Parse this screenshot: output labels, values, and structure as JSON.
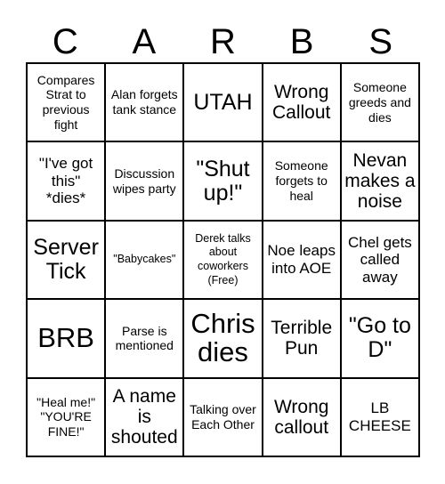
{
  "card": {
    "title_letters": [
      "C",
      "A",
      "R",
      "B",
      "S"
    ],
    "columns": 5,
    "rows": 5,
    "colors": {
      "grid_line": "#000000",
      "background": "#ffffff",
      "text": "#000000"
    },
    "cells": [
      {
        "text": "Compares Strat to previous fight",
        "size": "sm"
      },
      {
        "text": "Alan forgets tank stance",
        "size": "sm"
      },
      {
        "text": "UTAH",
        "size": "xl"
      },
      {
        "text": "Wrong Callout",
        "size": "lg"
      },
      {
        "text": "Someone greeds and dies",
        "size": "sm"
      },
      {
        "text": "\"I've got this\" *dies*",
        "size": "md"
      },
      {
        "text": "Discussion wipes party",
        "size": "sm"
      },
      {
        "text": "\"Shut up!\"",
        "size": "xl"
      },
      {
        "text": "Someone forgets to heal",
        "size": "sm"
      },
      {
        "text": "Nevan makes a noise",
        "size": "lg"
      },
      {
        "text": "Server Tick",
        "size": "xl"
      },
      {
        "text": "\"Babycakes\"",
        "size": "xs"
      },
      {
        "text": "Derek talks about coworkers (Free)",
        "size": "xs"
      },
      {
        "text": "Noe leaps into AOE",
        "size": "md"
      },
      {
        "text": "Chel gets called away",
        "size": "md"
      },
      {
        "text": "BRB",
        "size": "xxl"
      },
      {
        "text": "Parse is mentioned",
        "size": "sm"
      },
      {
        "text": "Chris dies",
        "size": "xxl"
      },
      {
        "text": "Terrible Pun",
        "size": "lg"
      },
      {
        "text": "\"Go to D\"",
        "size": "xl"
      },
      {
        "text": "\"Heal me!\" \"YOU'RE FINE!\"",
        "size": "sm"
      },
      {
        "text": "A name is shouted",
        "size": "lg"
      },
      {
        "text": "Talking over Each Other",
        "size": "sm"
      },
      {
        "text": "Wrong callout",
        "size": "lg"
      },
      {
        "text": "LB CHEESE",
        "size": "md"
      }
    ]
  }
}
